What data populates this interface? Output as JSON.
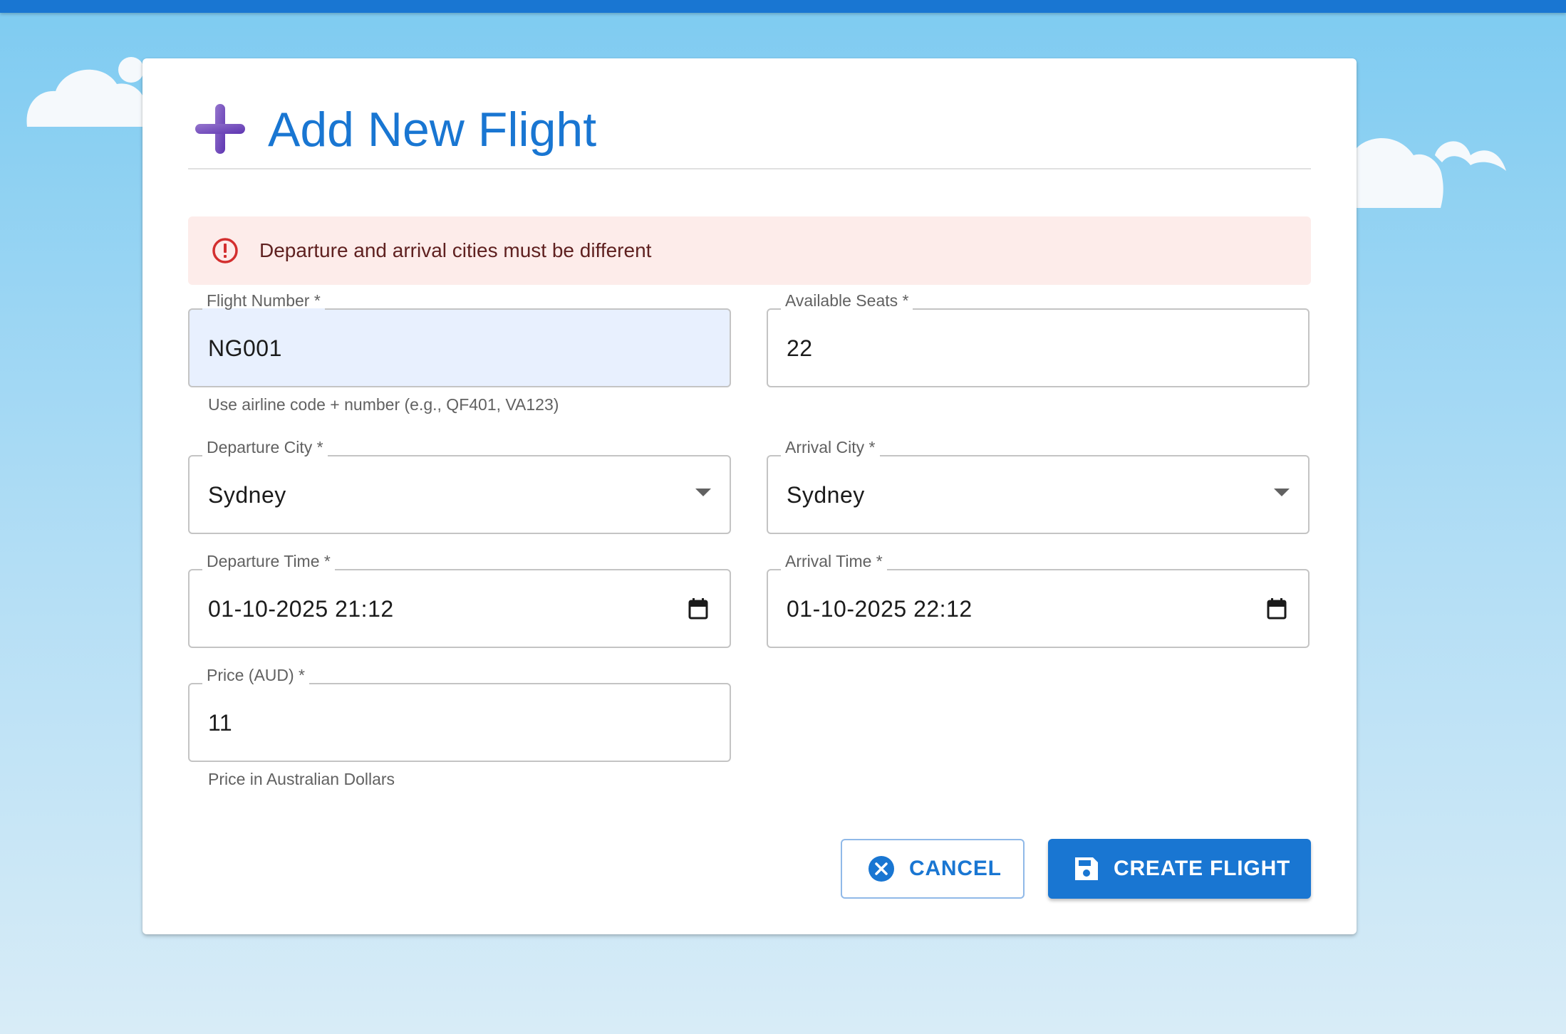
{
  "dialog": {
    "title": "Add New Flight",
    "error": "Departure and arrival cities must be different"
  },
  "fields": {
    "flight_number": {
      "label": "Flight Number *",
      "value": "NG001",
      "helper": "Use airline code + number (e.g., QF401, VA123)"
    },
    "available_seats": {
      "label": "Available Seats *",
      "value": "22"
    },
    "departure_city": {
      "label": "Departure City *",
      "value": "Sydney"
    },
    "arrival_city": {
      "label": "Arrival City *",
      "value": "Sydney"
    },
    "departure_time": {
      "label": "Departure Time *",
      "value": "01-10-2025 21:12"
    },
    "arrival_time": {
      "label": "Arrival Time *",
      "value": "01-10-2025 22:12"
    },
    "price": {
      "label": "Price (AUD) *",
      "value": "11",
      "helper": "Price in Australian Dollars"
    }
  },
  "actions": {
    "cancel_label": "CANCEL",
    "create_label": "CREATE FLIGHT"
  },
  "colors": {
    "primary": "#1976d2",
    "error_bg": "#fdecea",
    "error_icon": "#d32f2f",
    "plus_icon": "#7e57c2"
  },
  "icons": {
    "title": "plus-icon",
    "alert": "error-outline-icon",
    "cancel": "cancel-circle-icon",
    "create": "save-icon",
    "select": "caret-down-icon",
    "date": "calendar-icon"
  }
}
